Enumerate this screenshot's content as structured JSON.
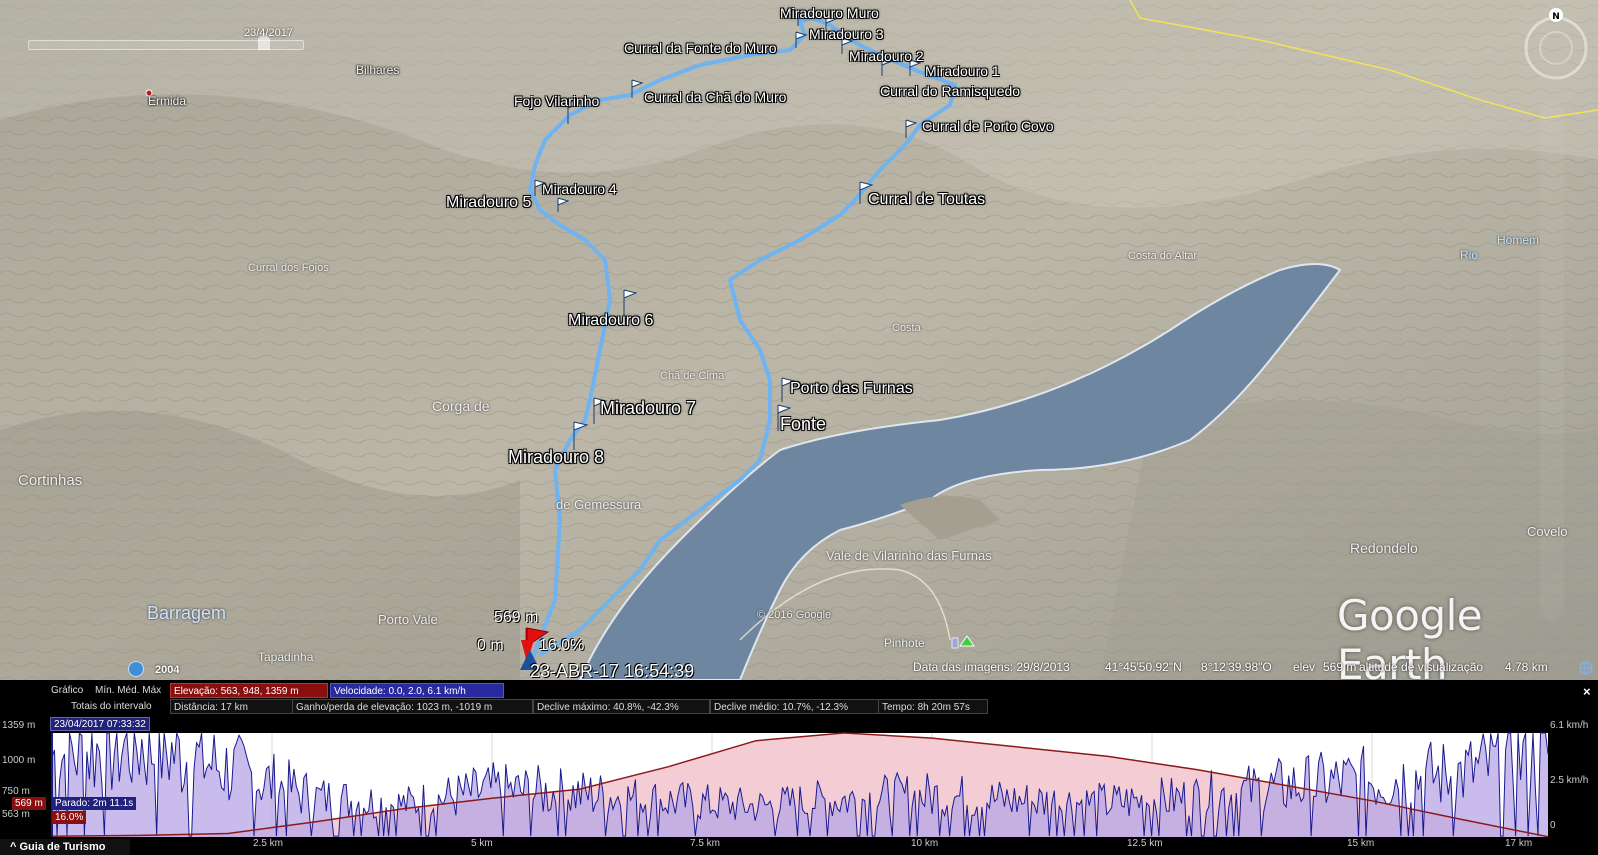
{
  "map": {
    "slider_date": "23/4/2017",
    "places": {
      "bilhares": "Bilhares",
      "ermida": "Ermida",
      "cortinhas": "Cortinhas",
      "corga": "Corga de",
      "homem": "Homem",
      "rio": "Rio",
      "barragem": "Barragem",
      "porto_vale": "Porto Vale",
      "tapadinha": "Tapadinha",
      "pinhote": "Pinhote",
      "covelo": "Covelo",
      "redondelo": "Redondelo",
      "vale_vilarinho": "Vale de Vilarinho das Furnas",
      "gemessura": "de Gemessura",
      "curral_fojos": "Curral dos Fojos",
      "costa": "Costa",
      "costa_altar": "Costa do Altar",
      "cha_cima": "Chã de Cima"
    },
    "waypoints": {
      "miradouro_muro": "Miradouro Muro",
      "miradouro_3": "Miradouro 3",
      "curral_fonte_muro": "Curral da Fonte do Muro",
      "miradouro_2": "Miradouro 2",
      "miradouro_1": "Miradouro 1",
      "curral_ramisquedo": "Curral do Ramisquedo",
      "fojo_vilarinho": "Fojo Vilarinho",
      "curral_cha_muro": "Curral da Chã do Muro",
      "curral_porto_covo": "Curral de Porto Covo",
      "miradouro_4": "Miradouro 4",
      "miradouro_5": "Miradouro 5",
      "curral_toutas": "Curral de Toutas",
      "miradouro_6": "Miradouro 6",
      "porto_furnas": "Porto das Furnas",
      "miradouro_7": "Miradouro 7",
      "fonte": "Fonte",
      "miradouro_8": "Miradouro 8"
    },
    "cursor": {
      "elevation": "569 m",
      "distance": "0 m",
      "slope": "16.0%",
      "timestamp": "23-ABR-17 16:54:39"
    },
    "copyright": "© 2016 Google",
    "logo": "Google Earth",
    "historical_year": "2004",
    "status": {
      "image_date": "Data das imagens: 29/8/2013",
      "lat": "41°45'50.92\"N",
      "lon": "8°12'39.98\"O",
      "elev_label": "elev",
      "elev": "569 m",
      "eye_alt_label": "altitude de visualização",
      "eye_alt": "4.78 km"
    },
    "compass_north": "N",
    "colors": {
      "track": "#6fb3f0",
      "lake": "#6e86a0",
      "terrain": "#b9b3a4"
    }
  },
  "profile": {
    "row1": {
      "graph": "Gráfico",
      "minmax": "Mín. Méd. Máx",
      "elevation": "Elevação: 563, 948, 1359 m",
      "speed": "Velocidade: 0.0, 2.0, 6.1 km/h"
    },
    "row2": {
      "totals": "Totais do intervalo",
      "distance": "Distância: 17 km",
      "gain": "Ganho/perda de elevação: 1023 m, -1019 m",
      "max_slope": "Declive máximo: 40.8%, -42.3%",
      "avg_slope": "Declive médio: 10.7%, -12.3%",
      "time": "Tempo: 8h 20m 57s"
    },
    "start_date": "23/04/2017 07:33:32",
    "close": "×",
    "y_left": [
      "1359 m",
      "1000 m",
      "750 m",
      "563 m"
    ],
    "y_right": [
      "6.1 km/h",
      "2.5 km/h",
      "0"
    ],
    "x_ticks": [
      "2.5 km",
      "5 km",
      "7.5 km",
      "10 km",
      "12.5 km",
      "15 km",
      "17 km"
    ],
    "cursor_elev": "569 m",
    "cursor_slope": "16.0%",
    "stopped": "Parado: 2m 11.1s",
    "guide": "Guia de Turismo",
    "colors": {
      "elevation_line": "#8b1a1a",
      "speed_line": "#1a1a90",
      "elevation_fill": "#f4cdd4",
      "speed_fill": "#b7a6e6"
    }
  },
  "chart_data": {
    "type": "area",
    "xlabel": "",
    "ylabel": "",
    "x_unit": "km",
    "xlim": [
      0,
      17
    ],
    "ylim": [
      563,
      1359
    ],
    "y2lim": [
      0,
      6.1
    ],
    "x": [
      0,
      1,
      2,
      3,
      4,
      5,
      6,
      7,
      8,
      9,
      10,
      11,
      12,
      13,
      14,
      15,
      16,
      17
    ],
    "series": [
      {
        "name": "Elevação",
        "values": [
          569,
          575,
          590,
          680,
          780,
          860,
          930,
          1100,
          1300,
          1359,
          1320,
          1250,
          1180,
          1080,
          960,
          840,
          700,
          565
        ]
      },
      {
        "name": "Velocidade",
        "values": [
          4.5,
          5.2,
          3.8,
          2.2,
          1.8,
          2.6,
          2.4,
          2.0,
          1.7,
          2.1,
          2.3,
          2.0,
          1.9,
          2.2,
          2.8,
          3.2,
          3.5,
          4.8
        ]
      }
    ]
  }
}
